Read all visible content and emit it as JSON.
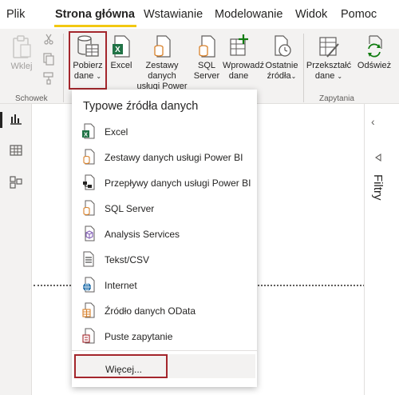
{
  "tabs": [
    {
      "label": "Plik",
      "active": false
    },
    {
      "label": "Strona główna",
      "active": true
    },
    {
      "label": "Wstawianie",
      "active": false
    },
    {
      "label": "Modelowanie",
      "active": false
    },
    {
      "label": "Widok",
      "active": false
    },
    {
      "label": "Pomoc",
      "active": false
    }
  ],
  "ribbon": {
    "paste": {
      "label": "Wklej",
      "icon": "clipboard-icon",
      "disabled": true
    },
    "cut_icon": "scissors-icon",
    "copy_icon": "copy-icon",
    "format_painter_icon": "format-painter-icon",
    "get_data": {
      "line1": "Pobierz",
      "line2": "dane",
      "icon": "database-table-icon"
    },
    "excel": {
      "label": "Excel",
      "icon": "excel-icon"
    },
    "powerbi_datasets": {
      "line1": "Zestawy danych",
      "line2": "usługi Power BI",
      "icon": "dataset-icon"
    },
    "sql_server": {
      "line1": "SQL",
      "line2": "Server",
      "icon": "sql-server-icon"
    },
    "enter_data": {
      "line1": "Wprowadź",
      "line2": "dane",
      "icon": "table-plus-icon"
    },
    "recent_sources": {
      "line1": "Ostatnie",
      "line2": "źródła",
      "icon": "clock-icon"
    },
    "transform": {
      "line1": "Przekształć",
      "line2": "dane",
      "icon": "transform-icon"
    },
    "refresh": {
      "label": "Odśwież",
      "icon": "refresh-icon"
    },
    "groups": {
      "clipboard": "Schowek",
      "queries": "Zapytania"
    }
  },
  "menu": {
    "title": "Typowe źródła danych",
    "items": [
      {
        "label": "Excel",
        "icon": "excel-icon"
      },
      {
        "label": "Zestawy danych usługi Power BI",
        "icon": "dataset-icon"
      },
      {
        "label": "Przepływy danych usługi Power BI",
        "icon": "dataflow-icon"
      },
      {
        "label": "SQL Server",
        "icon": "sql-server-icon"
      },
      {
        "label": "Analysis Services",
        "icon": "cube-icon"
      },
      {
        "label": "Tekst/CSV",
        "icon": "text-file-icon"
      },
      {
        "label": "Internet",
        "icon": "globe-icon"
      },
      {
        "label": "Źródło danych OData",
        "icon": "odata-icon"
      },
      {
        "label": "Puste zapytanie",
        "icon": "blank-query-icon"
      }
    ],
    "more": "Więcej..."
  },
  "right_pane": {
    "collapse_icon": "chevron-left-icon",
    "filters_label": "Filtry",
    "filters_icon": "filter-triangle-icon"
  },
  "rail": [
    "report-view-icon",
    "data-view-icon",
    "model-view-icon"
  ],
  "colors": {
    "accent": "#f2c811",
    "highlight_box": "#a4262c",
    "ribbon_bg": "#f3f2f1",
    "excel_green": "#217346",
    "dataset_orange": "#d9822b"
  }
}
